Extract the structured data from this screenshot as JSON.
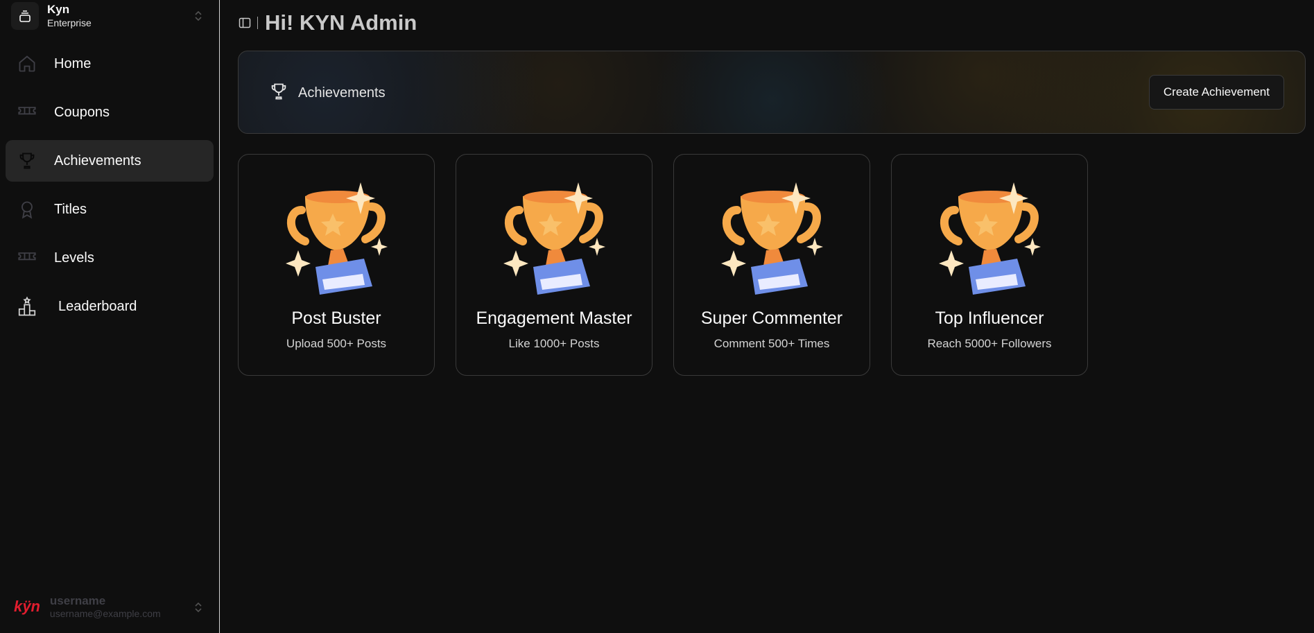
{
  "org": {
    "name": "Kyn",
    "plan": "Enterprise"
  },
  "nav": [
    {
      "label": "Home",
      "icon": "home-icon"
    },
    {
      "label": "Coupons",
      "icon": "ticket-icon"
    },
    {
      "label": "Achievements",
      "icon": "trophy-icon",
      "active": true
    },
    {
      "label": "Titles",
      "icon": "award-icon"
    },
    {
      "label": "Levels",
      "icon": "ticket-icon"
    },
    {
      "label": "Leaderboard",
      "icon": "podium-icon"
    }
  ],
  "user": {
    "logo": "kÿn",
    "name": "username",
    "email": "username@example.com"
  },
  "header": {
    "greeting": "Hi! KYN Admin"
  },
  "banner": {
    "title": "Achievements",
    "create_label": "Create Achievement"
  },
  "achievements": [
    {
      "title": "Post Buster",
      "description": "Upload 500+ Posts"
    },
    {
      "title": "Engagement Master",
      "description": "Like 1000+ Posts"
    },
    {
      "title": "Super Commenter",
      "description": "Comment 500+ Times"
    },
    {
      "title": "Top Influencer",
      "description": "Reach 5000+ Followers"
    }
  ],
  "colors": {
    "accent_red": "#e11d2e",
    "trophy_gold": "#f6a94a",
    "trophy_base": "#6f8fe8",
    "sparkle": "#fde7c0"
  }
}
